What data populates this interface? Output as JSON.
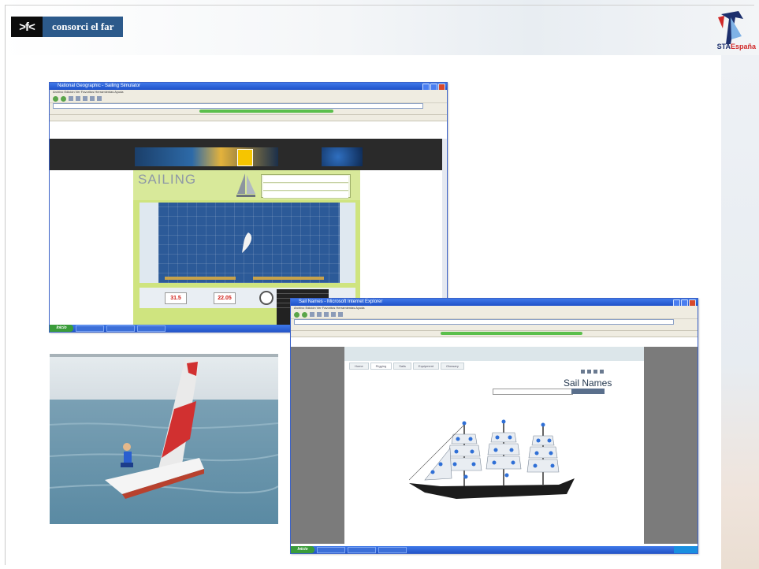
{
  "slide": {
    "logo_mark": ">f<",
    "logo_text": "consorci el far",
    "sta_logo": "STAEspaña"
  },
  "sailing_window": {
    "title": "National Geographic - Sailing Simulator",
    "menu": "Archivo   Edición   Ver   Favoritos   Herramientas   Ayuda",
    "game_title": "SAILING",
    "readout_left": "31.5",
    "readout_right": "22.05",
    "start_label": "Inicio"
  },
  "sail_names_window": {
    "title": "Sail Names - Microsoft Internet Explorer",
    "menu": "Archivo   Edición   Ver   Favoritos   Herramientas   Ayuda",
    "tabs": [
      "Home",
      "Rigging",
      "Sails",
      "Equipment",
      "Glossary"
    ],
    "heading": "Sail Names",
    "start_label": "Inicio"
  },
  "colors": {
    "xp_blue": "#2455c8",
    "ocean": "#2c5a98",
    "accent_red": "#d02828"
  }
}
